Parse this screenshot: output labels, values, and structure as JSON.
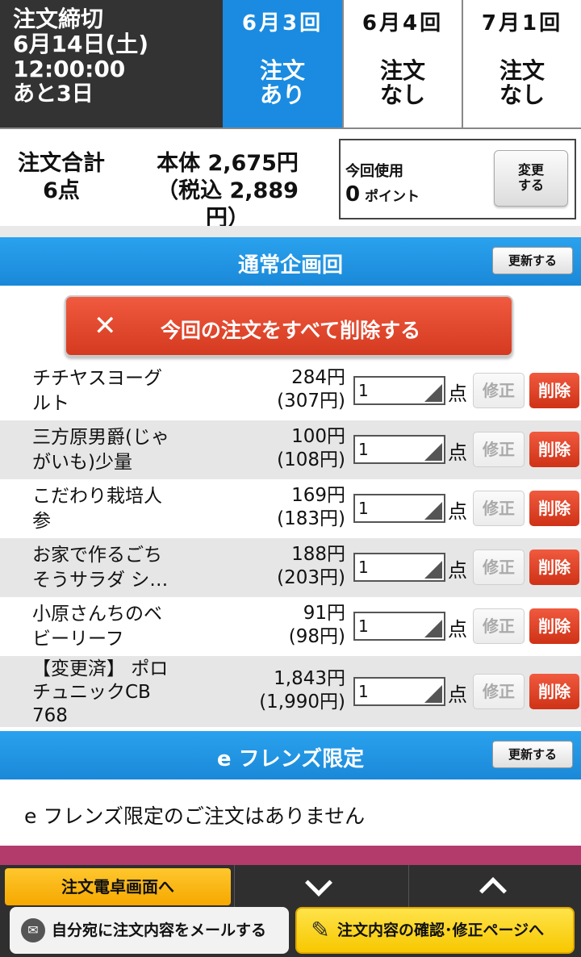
{
  "deadline": {
    "title": "注文締切",
    "date": "6月14日(土)",
    "time": "12:00:00",
    "remaining": "あと3日"
  },
  "tabs": [
    {
      "date": "6月3回",
      "status_line1": "注文",
      "status_line2": "あり"
    },
    {
      "date": "6月4回",
      "status_line1": "注文",
      "status_line2": "なし"
    },
    {
      "date": "7月1回",
      "status_line1": "注文",
      "status_line2": "なし"
    }
  ],
  "summary": {
    "total_label": "注文合計",
    "count": "6点",
    "price_line": "本体 2,675円",
    "tax_line": "（税込 2,889円）",
    "points_label": "今回使用",
    "points_value": "0",
    "points_unit": "ポイント",
    "change_line1": "変更",
    "change_line2": "する"
  },
  "section_regular": {
    "title": "通常企画回",
    "update_label": "更新する",
    "delete_all_label": "今回の注文をすべて削除する"
  },
  "items": [
    {
      "name_line1": "チチヤスヨーグ",
      "name_line2": "ルト",
      "name_line3": "",
      "price": "284円",
      "tax_price": "(307円)",
      "qty": "1",
      "unit": "点",
      "fix": "修正",
      "delete": "削除"
    },
    {
      "name_line1": "三方原男爵(じゃ",
      "name_line2": "がいも)少量",
      "name_line3": "",
      "price": "100円",
      "tax_price": "(108円)",
      "qty": "1",
      "unit": "点",
      "fix": "修正",
      "delete": "削除"
    },
    {
      "name_line1": "こだわり栽培人",
      "name_line2": "参",
      "name_line3": "",
      "price": "169円",
      "tax_price": "(183円)",
      "qty": "1",
      "unit": "点",
      "fix": "修正",
      "delete": "削除"
    },
    {
      "name_line1": "お家で作るごち",
      "name_line2": "そうサラダ シ…",
      "name_line3": "",
      "price": "188円",
      "tax_price": "(203円)",
      "qty": "1",
      "unit": "点",
      "fix": "修正",
      "delete": "削除"
    },
    {
      "name_line1": "小原さんちのベ",
      "name_line2": "ビーリーフ",
      "name_line3": "",
      "price": "91円",
      "tax_price": "(98円)",
      "qty": "1",
      "unit": "点",
      "fix": "修正",
      "delete": "削除"
    },
    {
      "name_line1": "【変更済】 ポロ",
      "name_line2": "チュニックCB",
      "name_line3": "768",
      "price": "1,843円",
      "tax_price": "(1,990円)",
      "qty": "1",
      "unit": "点",
      "fix": "修正",
      "delete": "削除"
    }
  ],
  "section_efriends": {
    "title": "e フレンズ限定",
    "update_label": "更新する",
    "empty_message": "e フレンズ限定のご注文はありません"
  },
  "bottom": {
    "calc_label": "注文電卓画面へ",
    "mail_label": "自分宛に注文内容をメールする",
    "confirm_label": "注文内容の確認･修正ページへ"
  },
  "icons": {
    "close": "close-icon",
    "mail": "mail-icon",
    "pencil": "pencil-icon",
    "down": "chevron-down-icon",
    "up": "chevron-up-icon"
  },
  "colors": {
    "active_tab": "#1a8be0",
    "section_header": "#1a88d8",
    "delete_red": "#d43a20",
    "calc_yellow": "#f5a800",
    "confirm_yellow": "#f7c800",
    "dark_bg": "#333333"
  }
}
